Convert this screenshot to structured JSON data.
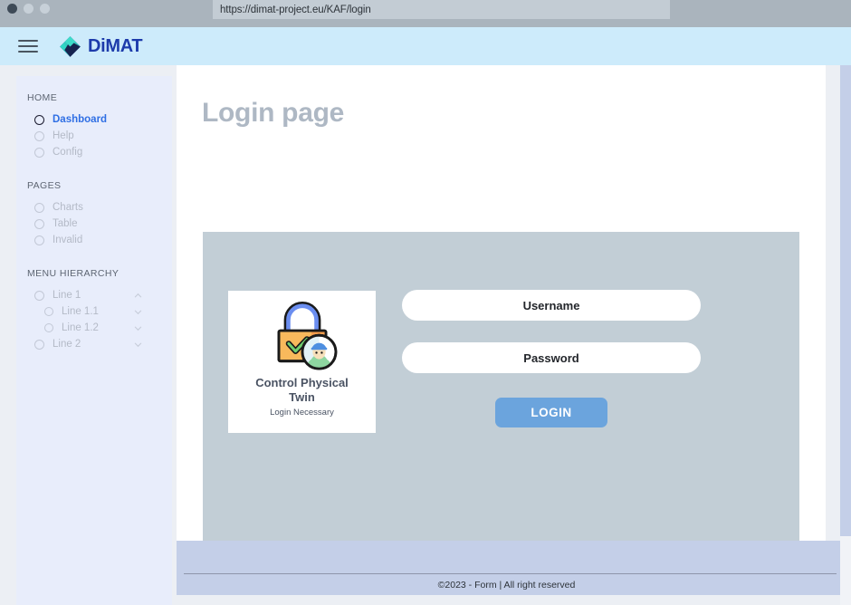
{
  "browser": {
    "url": "https://dimat-project.eu/KAF/login",
    "traffic_lights": [
      "close",
      "minimize",
      "maximize"
    ]
  },
  "header": {
    "menu_icon": "hamburger-menu-icon",
    "brand_name": "DiMAT",
    "brand_logo": "diamond-logo-icon",
    "background": "#cdebfb",
    "brand_color": "#1d3bab"
  },
  "sidebar": {
    "groups": [
      {
        "title": "HOME",
        "items": [
          {
            "label": "Dashboard",
            "active": true,
            "expandable": false
          },
          {
            "label": "Help",
            "active": false,
            "expandable": false
          },
          {
            "label": "Config",
            "active": false,
            "expandable": false
          }
        ]
      },
      {
        "title": "PAGES",
        "items": [
          {
            "label": "Charts",
            "active": false,
            "expandable": false
          },
          {
            "label": "Table",
            "active": false,
            "expandable": false
          },
          {
            "label": "Invalid",
            "active": false,
            "expandable": false
          }
        ]
      },
      {
        "title": "MENU HIERARCHY",
        "items": [
          {
            "label": "Line 1",
            "active": false,
            "expandable": true,
            "chevron": "chevron-up",
            "level": 1
          },
          {
            "label": "Line 1.1",
            "active": false,
            "expandable": true,
            "chevron": "chevron-down",
            "level": 2
          },
          {
            "label": "Line 1.2",
            "active": false,
            "expandable": true,
            "chevron": "chevron-down",
            "level": 2
          },
          {
            "label": "Line 2",
            "active": false,
            "expandable": true,
            "chevron": "chevron-down",
            "level": 1
          }
        ]
      }
    ],
    "active_color": "#2f6fe4"
  },
  "main": {
    "title": "Login page",
    "panel_color": "#c2ced6",
    "tile": {
      "icon": "padlock-with-user-icon",
      "title": "Control Physical Twin",
      "subtitle": "Login Necessary"
    },
    "form": {
      "username_placeholder": "Username",
      "username_value": "",
      "password_placeholder": "Password",
      "password_value": "",
      "login_label": "LOGIN",
      "login_button_color": "#6ba4dd"
    }
  },
  "footer": {
    "text": "©2023 - Form  |   All right reserved",
    "background": "#c4cfe8"
  }
}
